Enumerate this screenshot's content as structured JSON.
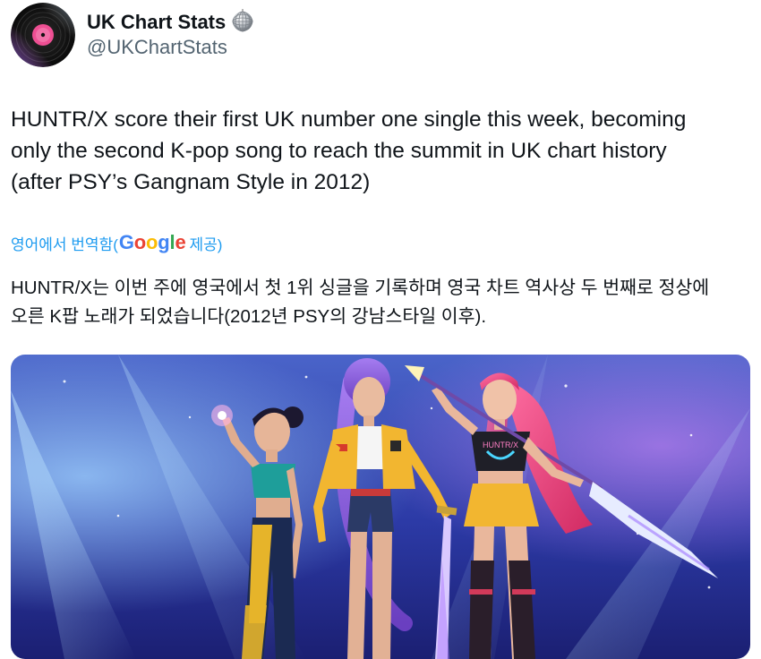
{
  "author": {
    "display_name": "UK Chart Stats",
    "handle": "@UKChartStats",
    "badge_icon": "disco-ball-icon",
    "avatar_icon": "vinyl-record-icon"
  },
  "tweet": {
    "text_lines": [
      "HUNTR/X score their first UK number one single this week, becoming",
      "only the second K-pop song to reach the summit in UK chart history",
      "(after PSY’s Gangnam Style in 2012)"
    ]
  },
  "translation": {
    "prefix": "영어에서 번역함(",
    "google_letters": [
      {
        "char": "G",
        "color": "#4285F4"
      },
      {
        "char": "o",
        "color": "#EA4335"
      },
      {
        "char": "o",
        "color": "#FBBC05"
      },
      {
        "char": "g",
        "color": "#4285F4"
      },
      {
        "char": "l",
        "color": "#34A853"
      },
      {
        "char": "e",
        "color": "#EA4335"
      }
    ],
    "suffix": " 제공)",
    "text_lines": [
      "HUNTR/X는 이번 주에 영국에서 첫 1위 싱글을 기록하며 영국 차트 역사상 두 번째로 정상에",
      "오른 K팝 노래가 되었습니다(2012년 PSY의 강남스타일 이후)."
    ]
  },
  "media": {
    "image_icon": "animated-group-illustration",
    "t_shirt_text": "HUNTR/X"
  },
  "colors": {
    "text_primary": "#0f1419",
    "text_secondary": "#536471",
    "link": "#1d9bf0"
  }
}
